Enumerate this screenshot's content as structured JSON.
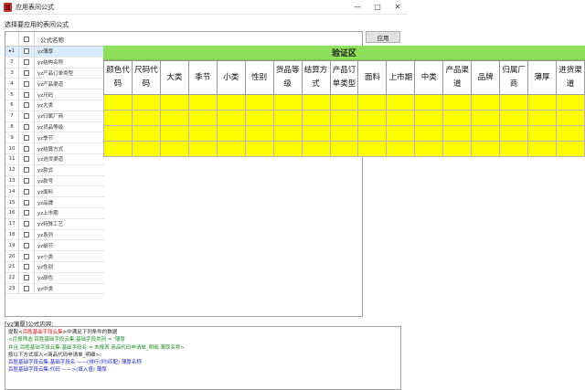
{
  "window": {
    "title": "应用表间公式",
    "minimize": "—",
    "maximize": "□",
    "close": "✕"
  },
  "prompt_label": "选择要应用的表间公式",
  "apply_button": "应用",
  "grid": {
    "header_name": "公式名称",
    "rows": [
      {
        "no": "▸1",
        "name": "yz薄厚",
        "selected": true
      },
      {
        "no": "2",
        "name": "yz结构名称"
      },
      {
        "no": "3",
        "name": "yz产品订单类型"
      },
      {
        "no": "4",
        "name": "yz产品渠道"
      },
      {
        "no": "5",
        "name": "yz尺码"
      },
      {
        "no": "6",
        "name": "yz大类"
      },
      {
        "no": "7",
        "name": "yz归属厂商"
      },
      {
        "no": "8",
        "name": "yz货品等级"
      },
      {
        "no": "9",
        "name": "yz季节"
      },
      {
        "no": "10",
        "name": "yz结算方式"
      },
      {
        "no": "11",
        "name": "yz进货渠道"
      },
      {
        "no": "12",
        "name": "yz款式"
      },
      {
        "no": "13",
        "name": "yz款号"
      },
      {
        "no": "14",
        "name": "yz面料"
      },
      {
        "no": "15",
        "name": "yz品牌"
      },
      {
        "no": "16",
        "name": "yz上市期"
      },
      {
        "no": "17",
        "name": "yz特殊工艺"
      },
      {
        "no": "18",
        "name": "yz系列"
      },
      {
        "no": "19",
        "name": "yz细节"
      },
      {
        "no": "20",
        "name": "yz小类"
      },
      {
        "no": "21",
        "name": "yz性别"
      },
      {
        "no": "22",
        "name": "yz颜色"
      },
      {
        "no": "23",
        "name": "yz中类"
      }
    ]
  },
  "verify": {
    "title": "验证区",
    "columns": [
      "颜色代码",
      "尺码代码",
      "大类",
      "季节",
      "小类",
      "性别",
      "货品等级",
      "结算方式",
      "产品订单类型",
      "面料",
      "上市期",
      "中类",
      "产品渠道",
      "品牌",
      "归属厂商",
      "薄厚",
      "进货渠道"
    ],
    "data_rows": 4
  },
  "formula": {
    "label": "[yz薄厚]公式内容:",
    "lines": [
      [
        {
          "t": "提取<",
          "c": "dark"
        },
        {
          "t": "百胜基础字段云集",
          "c": "red"
        },
        {
          "t": ">中满足下列条件的数据",
          "c": "dark"
        }
      ],
      [
        {
          "t": "    <月报筛选  百胜基础字段云集.基础字段类别 = '薄厚'",
          "c": "green"
        }
      ],
      [
        {
          "t": "        并且 百胜基础字段云集.基础字段名 = 本报表.商品代码申请单_明细.薄厚名称>",
          "c": "green"
        }
      ],
      [
        {
          "t": "按以下方式填入<商品代码申请单_明细>:",
          "c": "dark"
        }
      ],
      [
        {
          "t": "百胜基础字段云集.基础字段名  ——(排行(列)匹配)   薄厚名称",
          "c": "blue"
        }
      ],
      [
        {
          "t": "百胜基础字段云集.代码    ——>(填入值)  薄厚",
          "c": "blue"
        }
      ]
    ]
  }
}
